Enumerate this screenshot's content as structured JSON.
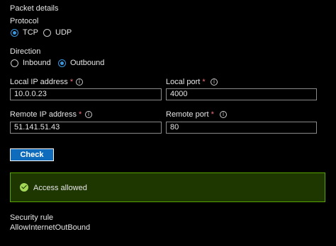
{
  "section_title": "Packet details",
  "protocol": {
    "label": "Protocol",
    "options": [
      {
        "label": "TCP",
        "selected": true
      },
      {
        "label": "UDP",
        "selected": false
      }
    ]
  },
  "direction": {
    "label": "Direction",
    "options": [
      {
        "label": "Inbound",
        "selected": false
      },
      {
        "label": "Outbound",
        "selected": true
      }
    ]
  },
  "fields": {
    "local_ip": {
      "label": "Local IP address",
      "required": "*",
      "value": "10.0.0.23"
    },
    "local_port": {
      "label": "Local port",
      "required": "*",
      "value": "4000"
    },
    "remote_ip": {
      "label": "Remote IP address",
      "required": "*",
      "value": "51.141.51.43"
    },
    "remote_port": {
      "label": "Remote port",
      "required": "*",
      "value": "80"
    }
  },
  "check_button": {
    "label": "Check"
  },
  "result": {
    "message": "Access allowed",
    "status_color": "#a3d957"
  },
  "security_rule": {
    "label": "Security rule",
    "value": "AllowInternetOutBound"
  },
  "icons": {
    "info": "info-icon",
    "success": "check-circle-icon"
  },
  "colors": {
    "accent": "#0f6cbd",
    "success_bg": "#1e3600",
    "success_border": "#57a300",
    "required": "#f1707b"
  }
}
